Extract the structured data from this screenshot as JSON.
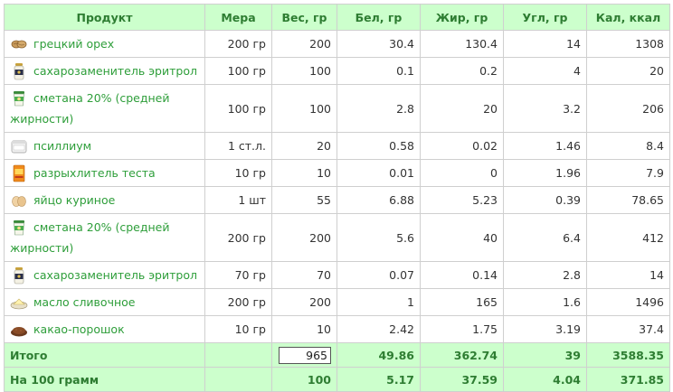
{
  "headers": [
    "Продукт",
    "Мера",
    "Вес, гр",
    "Бел, гр",
    "Жир, гр",
    "Угл, гр",
    "Кал, ккал"
  ],
  "rows": [
    {
      "icon": "walnut-icon",
      "name": "грецкий орех",
      "measure": "200 гр",
      "weight": "200",
      "protein": "30.4",
      "fat": "130.4",
      "carbs": "14",
      "kcal": "1308"
    },
    {
      "icon": "sweetener-jar-icon",
      "name": "сахарозаменитель эритрол",
      "measure": "100 гр",
      "weight": "100",
      "protein": "0.1",
      "fat": "0.2",
      "carbs": "4",
      "kcal": "20"
    },
    {
      "icon": "sour-cream-jar-icon",
      "name": "сметана 20% (средней жирности)",
      "measure": "100 гр",
      "weight": "100",
      "protein": "2.8",
      "fat": "20",
      "carbs": "3.2",
      "kcal": "206"
    },
    {
      "icon": "psyllium-container-icon",
      "name": "псиллиум",
      "measure": "1 ст.л.",
      "weight": "20",
      "protein": "0.58",
      "fat": "0.02",
      "carbs": "1.46",
      "kcal": "8.4"
    },
    {
      "icon": "baking-powder-pack-icon",
      "name": "разрыхлитель теста",
      "measure": "10 гр",
      "weight": "10",
      "protein": "0.01",
      "fat": "0",
      "carbs": "1.96",
      "kcal": "7.9"
    },
    {
      "icon": "eggs-icon",
      "name": "яйцо куриное",
      "measure": "1 шт",
      "weight": "55",
      "protein": "6.88",
      "fat": "5.23",
      "carbs": "0.39",
      "kcal": "78.65"
    },
    {
      "icon": "sour-cream-jar-icon",
      "name": "сметана 20% (средней жирности)",
      "measure": "200 гр",
      "weight": "200",
      "protein": "5.6",
      "fat": "40",
      "carbs": "6.4",
      "kcal": "412"
    },
    {
      "icon": "sweetener-jar-icon",
      "name": "сахарозаменитель эритрол",
      "measure": "70 гр",
      "weight": "70",
      "protein": "0.07",
      "fat": "0.14",
      "carbs": "2.8",
      "kcal": "14"
    },
    {
      "icon": "butter-icon",
      "name": "масло сливочное",
      "measure": "200 гр",
      "weight": "200",
      "protein": "1",
      "fat": "165",
      "carbs": "1.6",
      "kcal": "1496"
    },
    {
      "icon": "cocoa-powder-icon",
      "name": "какао-порошок",
      "measure": "10 гр",
      "weight": "10",
      "protein": "2.42",
      "fat": "1.75",
      "carbs": "3.19",
      "kcal": "37.4"
    }
  ],
  "total": {
    "label": "Итого",
    "weight": "965",
    "protein": "49.86",
    "fat": "362.74",
    "carbs": "39",
    "kcal": "3588.35"
  },
  "per100": {
    "label": "На 100 грамм",
    "weight": "100",
    "protein": "5.17",
    "fat": "37.59",
    "carbs": "4.04",
    "kcal": "371.85"
  },
  "colors": {
    "header_bg": "#ccffcc",
    "header_text": "#2e7d32",
    "link": "#2e9e3a",
    "border": "#cfcfcf"
  }
}
